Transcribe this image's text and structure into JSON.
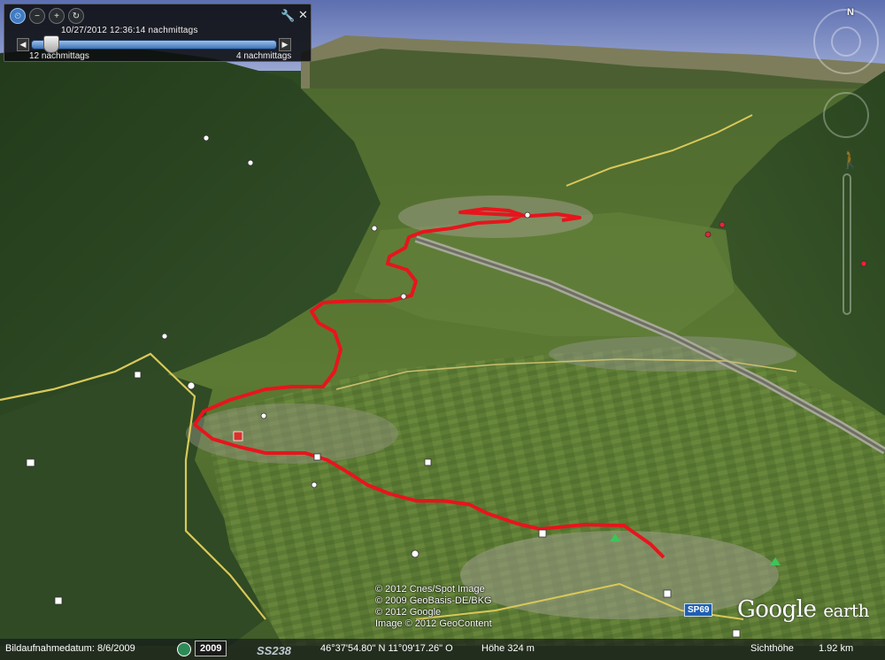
{
  "app": {
    "title": "Google Earth"
  },
  "time_slider": {
    "datetime": "10/27/2012  12:36:14 nachmittags",
    "start_label": "12 nachmittags",
    "end_label": "4 nachmittags",
    "icons": [
      "clock-icon",
      "zoom-out-icon",
      "zoom-in-icon",
      "refresh-icon"
    ],
    "position": 0.05
  },
  "navigation": {
    "north_label": "N"
  },
  "map": {
    "route_color": "#e8141c",
    "road_color": "#d8c85a",
    "sky_color": "#6f7fb8"
  },
  "shields": {
    "sp69": "SP69",
    "ss238": "SS238"
  },
  "copyright": {
    "line1": "© 2012 Cnes/Spot Image",
    "line2": "© 2009 GeoBasis-DE/BKG",
    "line3": "© 2012 Google",
    "line4": "Image © 2012 GeoContent"
  },
  "logo": {
    "google": "Google",
    "earth": "earth"
  },
  "status": {
    "imagery_date": "Bildaufnahmedatum: 8/6/2009",
    "year": "2009",
    "coordinates": "46°37'54.80\" N  11°09'17.26\" O",
    "elevation": "Höhe   324 m",
    "eye_alt_label": "Sichthöhe",
    "eye_alt_value": "1.92 km"
  }
}
